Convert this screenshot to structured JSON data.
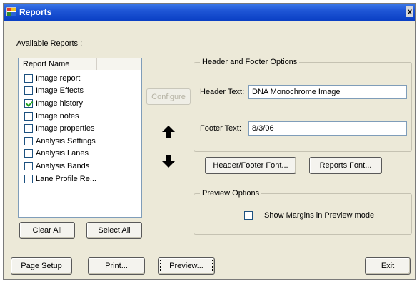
{
  "window": {
    "title": "Reports",
    "close_glyph": "x"
  },
  "available_reports_label": "Available Reports :",
  "list": {
    "column_header": "Report Name",
    "items": [
      {
        "label": "Image report",
        "checked": false
      },
      {
        "label": "Image Effects",
        "checked": false
      },
      {
        "label": "Image history",
        "checked": true
      },
      {
        "label": "Image notes",
        "checked": false
      },
      {
        "label": "Image properties",
        "checked": false
      },
      {
        "label": "Analysis Settings",
        "checked": false
      },
      {
        "label": "Analysis Lanes",
        "checked": false
      },
      {
        "label": "Analysis Bands",
        "checked": false
      },
      {
        "label": "Lane Profile Re...",
        "checked": false
      }
    ]
  },
  "buttons": {
    "configure": "Configure",
    "clear_all": "Clear All",
    "select_all": "Select All",
    "header_footer_font": "Header/Footer Font...",
    "reports_font": "Reports Font...",
    "page_setup": "Page Setup",
    "print": "Print...",
    "preview": "Preview...",
    "exit": "Exit"
  },
  "header_footer": {
    "group_title": "Header and Footer Options",
    "header_label": "Header Text:",
    "header_value": "DNA Monochrome Image",
    "footer_label": "Footer Text:",
    "footer_value": "8/3/06"
  },
  "preview_options": {
    "group_title": "Preview Options",
    "show_margins_label": "Show Margins in Preview mode",
    "show_margins_checked": false
  },
  "icons": {
    "app": "reports-app-icon",
    "move_up": "arrow-up-icon",
    "move_down": "arrow-down-icon"
  },
  "colors": {
    "titlebar": "#0a3fc4",
    "dialog_bg": "#ece9d8",
    "check_mark": "#21a121"
  }
}
